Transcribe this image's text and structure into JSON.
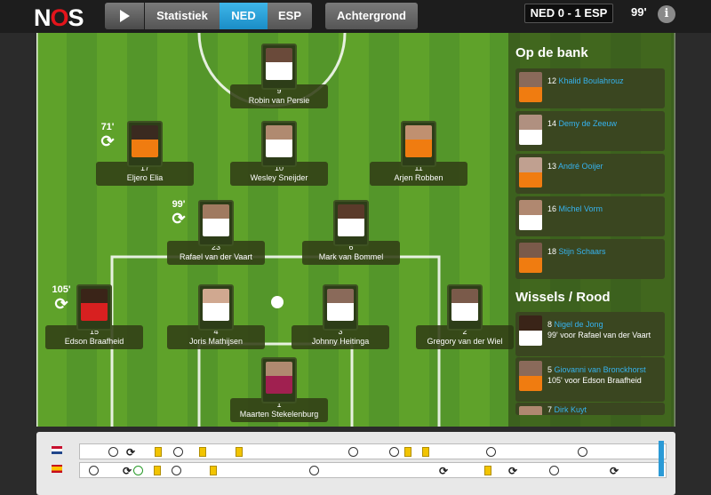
{
  "header": {
    "logo_n": "N",
    "logo_o": "O",
    "logo_s": "S",
    "tabs": [
      {
        "label": "Statistiek"
      },
      {
        "label": "NED",
        "active": true
      },
      {
        "label": "ESP"
      },
      {
        "label": "Achtergrond"
      }
    ],
    "score": "NED 0 - 1 ESP",
    "minute": "99'",
    "info": "i"
  },
  "colors": {
    "accent": "#1a8dc6",
    "link": "#36b3ef",
    "pitch": "#5fa22a",
    "card_yellow": "#f2c400"
  },
  "players": [
    {
      "number": "9",
      "name": "Robin van Persie",
      "jersey": "#ffffff"
    },
    {
      "number": "17",
      "name": "Eljero Elia",
      "jersey": "#f07c10"
    },
    {
      "number": "10",
      "name": "Wesley Sneijder",
      "jersey": "#ffffff"
    },
    {
      "number": "11",
      "name": "Arjen Robben",
      "jersey": "#f07c10"
    },
    {
      "number": "23",
      "name": "Rafael van der Vaart",
      "jersey": "#ffffff"
    },
    {
      "number": "6",
      "name": "Mark van Bommel",
      "jersey": "#ffffff"
    },
    {
      "number": "15",
      "name": "Edson Braafheid",
      "jersey": "#d82020"
    },
    {
      "number": "4",
      "name": "Joris Mathijsen",
      "jersey": "#ffffff"
    },
    {
      "number": "3",
      "name": "Johnny Heitinga",
      "jersey": "#ffffff"
    },
    {
      "number": "2",
      "name": "Gregory van der Wiel",
      "jersey": "#ffffff"
    },
    {
      "number": "1",
      "name": "Maarten Stekelenburg",
      "jersey": "#a02050"
    }
  ],
  "sub_markers": [
    {
      "minute": "71'",
      "icon": "substitution-icon"
    },
    {
      "minute": "99'",
      "icon": "substitution-icon"
    },
    {
      "minute": "105'",
      "icon": "substitution-icon"
    }
  ],
  "bench": {
    "title": "Op de bank",
    "items": [
      {
        "number": "12",
        "name": "Khalid Boulahrouz"
      },
      {
        "number": "14",
        "name": "Demy de Zeeuw"
      },
      {
        "number": "13",
        "name": "André Ooijer"
      },
      {
        "number": "16",
        "name": "Michel Vorm"
      },
      {
        "number": "18",
        "name": "Stijn Schaars"
      }
    ]
  },
  "subs": {
    "title": "Wissels / Rood",
    "items": [
      {
        "number": "8",
        "name": "Nigel de Jong",
        "detail": "99' voor Rafael van der Vaart"
      },
      {
        "number": "5",
        "name": "Giovanni van Bronckhorst",
        "detail": "105' voor Edson Braafheid"
      },
      {
        "number": "7",
        "name": "Dirk Kuyt",
        "detail": ""
      }
    ]
  },
  "timeline": {
    "teams": [
      {
        "flag": "nl-flag-icon"
      },
      {
        "flag": "es-flag-icon"
      }
    ]
  }
}
